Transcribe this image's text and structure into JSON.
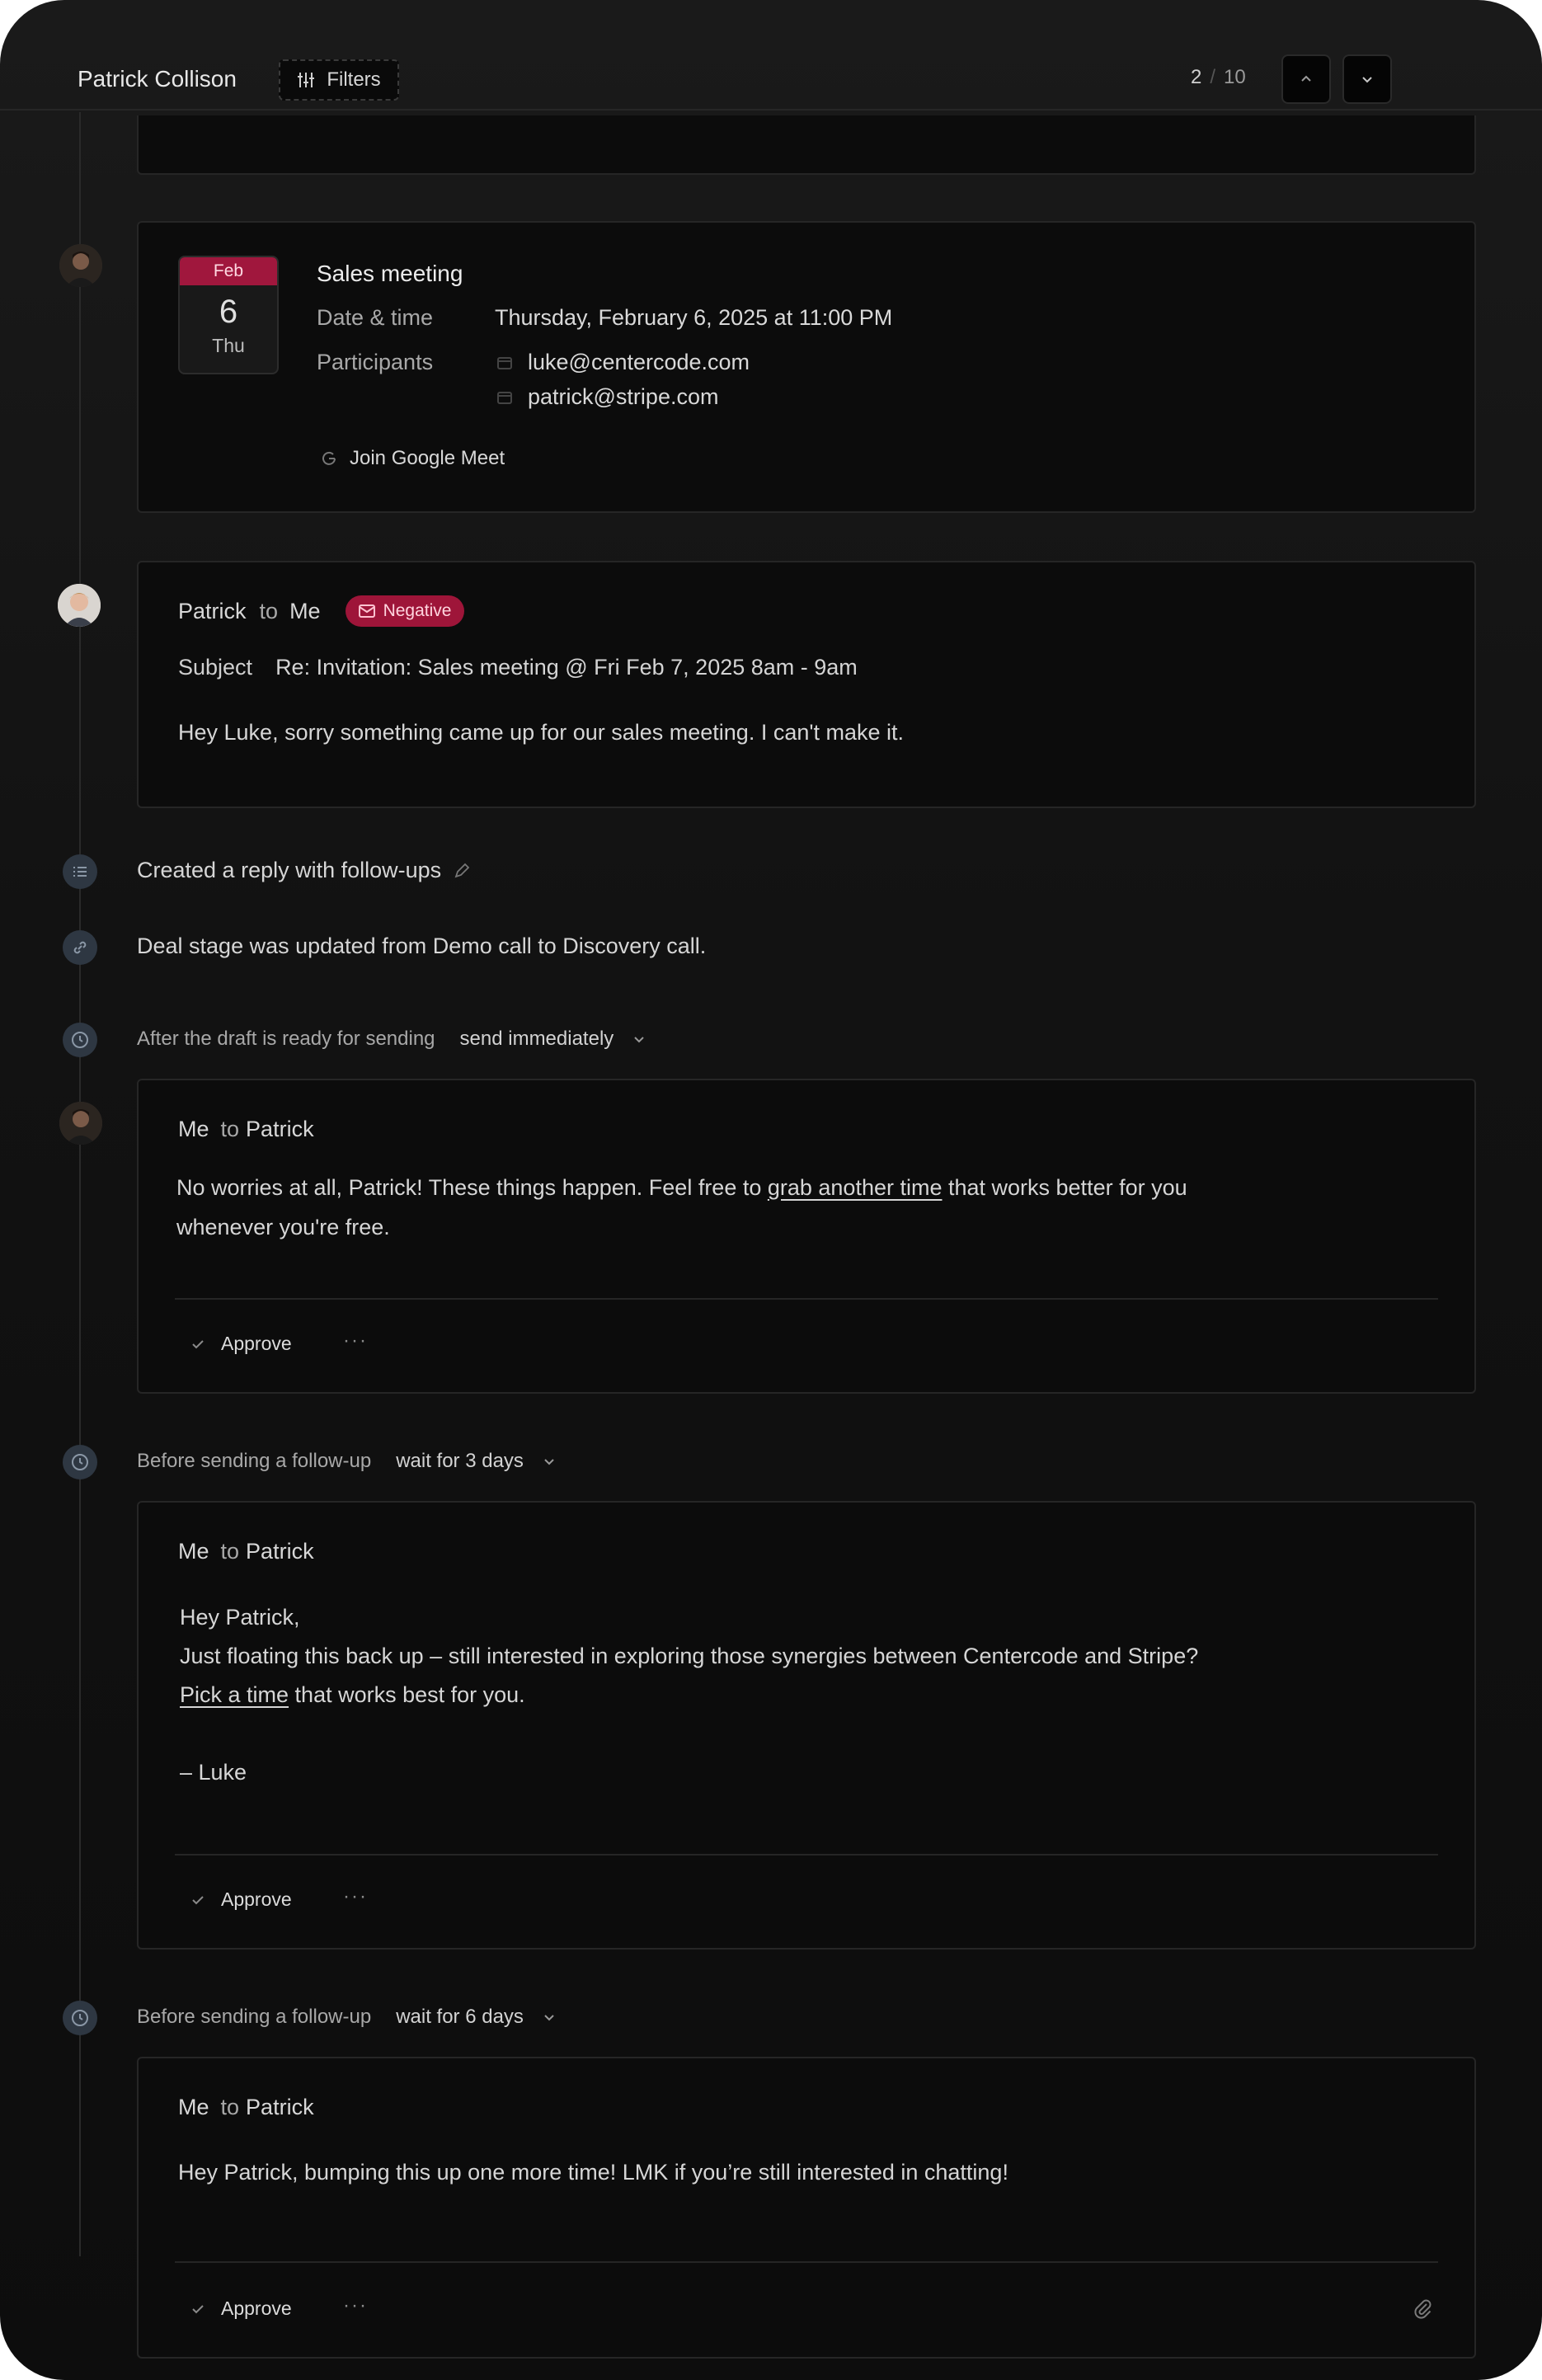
{
  "header": {
    "contact_name": "Patrick Collison",
    "filters_label": "Filters",
    "pager_current": "2",
    "pager_separator": "/",
    "pager_total": "10"
  },
  "event": {
    "month": "Feb",
    "day": "6",
    "weekday": "Thu",
    "title": "Sales meeting",
    "date_label": "Date & time",
    "date_value": "Thursday, February 6, 2025 at 11:00 PM",
    "participants_label": "Participants",
    "participants": [
      "luke@centercode.com",
      "patrick@stripe.com"
    ],
    "join_label": "Join Google Meet"
  },
  "incoming_email": {
    "from": "Patrick",
    "to_word": "to",
    "to": "Me",
    "sentiment": "Negative",
    "subject_label": "Subject",
    "subject": "Re: Invitation: Sales meeting @ Fri Feb 7, 2025 8am - 9am",
    "body": "Hey Luke, sorry something came up for our sales meeting. I can't make it."
  },
  "activities": {
    "reply_created": "Created a reply with follow-ups",
    "deal_stage": "Deal stage was updated from Demo call to Discovery call."
  },
  "rules": [
    {
      "label": "After the draft is ready for sending",
      "value": "send immediately"
    },
    {
      "label": "Before sending a follow-up",
      "value": "wait for 3 days"
    },
    {
      "label": "Before sending a follow-up",
      "value": "wait for 6 days"
    }
  ],
  "drafts": [
    {
      "from": "Me",
      "to_word": "to",
      "to": "Patrick",
      "line1_before": "No worries at all, Patrick! These things happen. Feel free to ",
      "line1_link": "grab another time",
      "line1_after": " that works better for you",
      "line2": "whenever you're free.",
      "approve": "Approve"
    },
    {
      "from": "Me",
      "to_word": "to",
      "to": "Patrick",
      "line1": "Hey Patrick,",
      "line2": "Just floating this back up – still interested in exploring those synergies between Centercode and Stripe?",
      "line3_link": "Pick a time",
      "line3_after": " that works best for you.",
      "line4": "– Luke",
      "approve": "Approve"
    },
    {
      "from": "Me",
      "to_word": "to",
      "to": "Patrick",
      "line1": "Hey Patrick, bumping this up one more time! LMK if you’re still interested in chatting!",
      "approve": "Approve"
    }
  ],
  "more_label": "···",
  "colors": {
    "negative_badge": "#9e1539",
    "calendar_month": "#a0173d",
    "background": "#121212"
  }
}
